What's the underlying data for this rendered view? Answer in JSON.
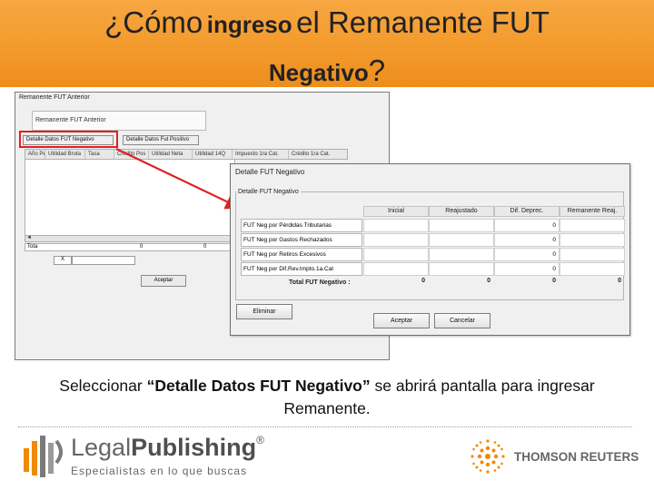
{
  "header": {
    "title_part1": "¿Cómo",
    "title_part2": "ingreso",
    "title_part3": "el Remanente FUT",
    "title_line2": "Negativo",
    "title_q": "?"
  },
  "back_window": {
    "title": "Remanente FUT Anterior",
    "field_label": "Remanente FUT Anterior",
    "tabs": [
      "Detalle Datos FUT Negativo",
      "Detalle Datos Fut Positivo"
    ],
    "grid_columns": [
      "Año Per",
      "Utilidad Bruta",
      "Tasa",
      "Crédito Pos",
      "Utilidad Neta",
      "Utilidad 14Q",
      "Impuesto 1ra Cat.",
      "Crédito 1ra Cat."
    ],
    "scroll_arrow": "◄",
    "total_label": "Tota",
    "total_value": "0",
    "total_value_2": "0",
    "combo_x": "X",
    "accept_label": "Aceptar"
  },
  "front_window": {
    "title": "Detalle FUT Negativo",
    "group_label": "Detalle FUT Negativo",
    "columns": [
      "Inicial",
      "Reajustado",
      "Dif. Deprec.",
      "Remanente Reaj."
    ],
    "rows": [
      {
        "label": "FUT Neg por Pérdidas Tributarias",
        "values": [
          "",
          "",
          "0",
          ""
        ]
      },
      {
        "label": "FUT Neg por Gastos Rechazados",
        "values": [
          "",
          "",
          "0",
          ""
        ]
      },
      {
        "label": "FUT Neg por Retiros Excesivos",
        "values": [
          "",
          "",
          "0",
          ""
        ]
      },
      {
        "label": "FUT Neg por Dif.Rev.Impto.1a.Cat",
        "values": [
          "",
          "",
          "0",
          ""
        ]
      }
    ],
    "total_label": "Total FUT Negativo :",
    "totals": [
      "0",
      "0",
      "0",
      "0"
    ],
    "delete_label": "Eliminar",
    "accept_label": "Aceptar",
    "cancel_label": "Cancelar"
  },
  "caption": {
    "pre": "Seleccionar ",
    "bold": "“Detalle Datos FUT Negativo”",
    "post": " se abrirá pantalla para ingresar Remanente."
  },
  "footer": {
    "legal": "Legal",
    "publishing": "Publishing",
    "registered": "®",
    "tagline": "Especialistas en lo que buscas",
    "thomson": "THOMSON REUTERS"
  },
  "colors": {
    "header_orange": "#f39a2c",
    "highlight_red": "#e02020",
    "thomson_orange": "#f08a00"
  }
}
